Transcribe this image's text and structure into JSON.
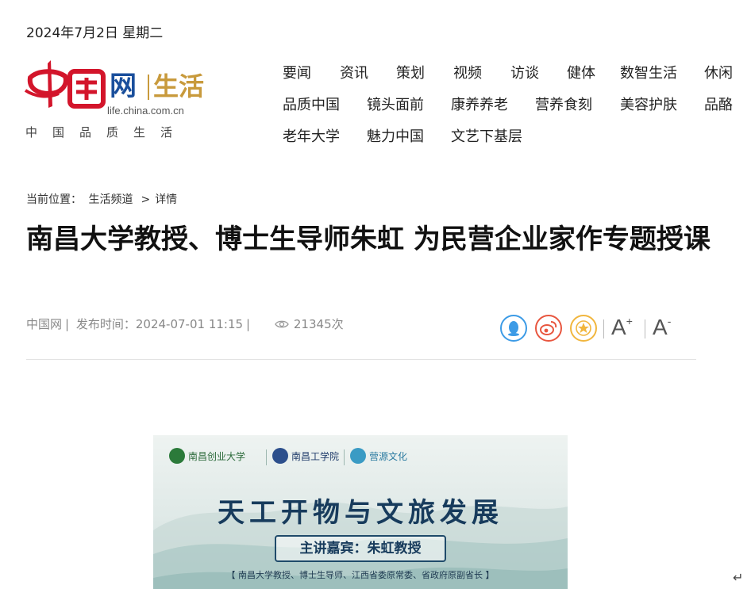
{
  "header": {
    "date": "2024年7月2日 星期二"
  },
  "logo": {
    "brand_main": "网",
    "brand_sub": "生活",
    "domain": "life.china.com.cn",
    "tagline": "中国品质生活"
  },
  "nav": {
    "row1": [
      "要闻",
      "资讯",
      "策划",
      "视频",
      "访谈",
      "健体",
      "数智生活",
      "休闲"
    ],
    "row2": [
      "品质中国",
      "镜头面前",
      "康养养老",
      "营养食刻",
      "美容护肤",
      "品酪"
    ],
    "row3": [
      "老年大学",
      "魅力中国",
      "文艺下基层"
    ]
  },
  "breadcrumb": {
    "label": "当前位置：",
    "channel": "生活频道",
    "separator": ">",
    "current": "详情"
  },
  "article": {
    "title": "南昌大学教授、博士生导师朱虹 为民营企业家作专题授课",
    "source": "中国网",
    "publish_label": "发布时间：",
    "publish_time": "2024-07-01 11:15",
    "views": "21345次"
  },
  "toolbar": {
    "font_increase": "A",
    "font_decrease": "A",
    "plus": "+",
    "minus": "-"
  },
  "poster": {
    "logo1": "南昌创业大学",
    "logo2": "南昌工学院",
    "logo3": "营源文化",
    "title": "天工开物与文旅发展",
    "speaker": "主讲嘉宾：朱虹教授",
    "subtitle": "【 南昌大学教授、博士生导师、江西省委原常委、省政府原副省长 】"
  },
  "colors": {
    "qq": "#3c9be6",
    "weibo": "#e8563f",
    "favorite": "#f1b63e",
    "logo_red": "#d3152b",
    "logo_blue": "#1a4f9c",
    "logo_gold": "#c89a3c"
  },
  "misc": {
    "return_symbol": "↵"
  }
}
